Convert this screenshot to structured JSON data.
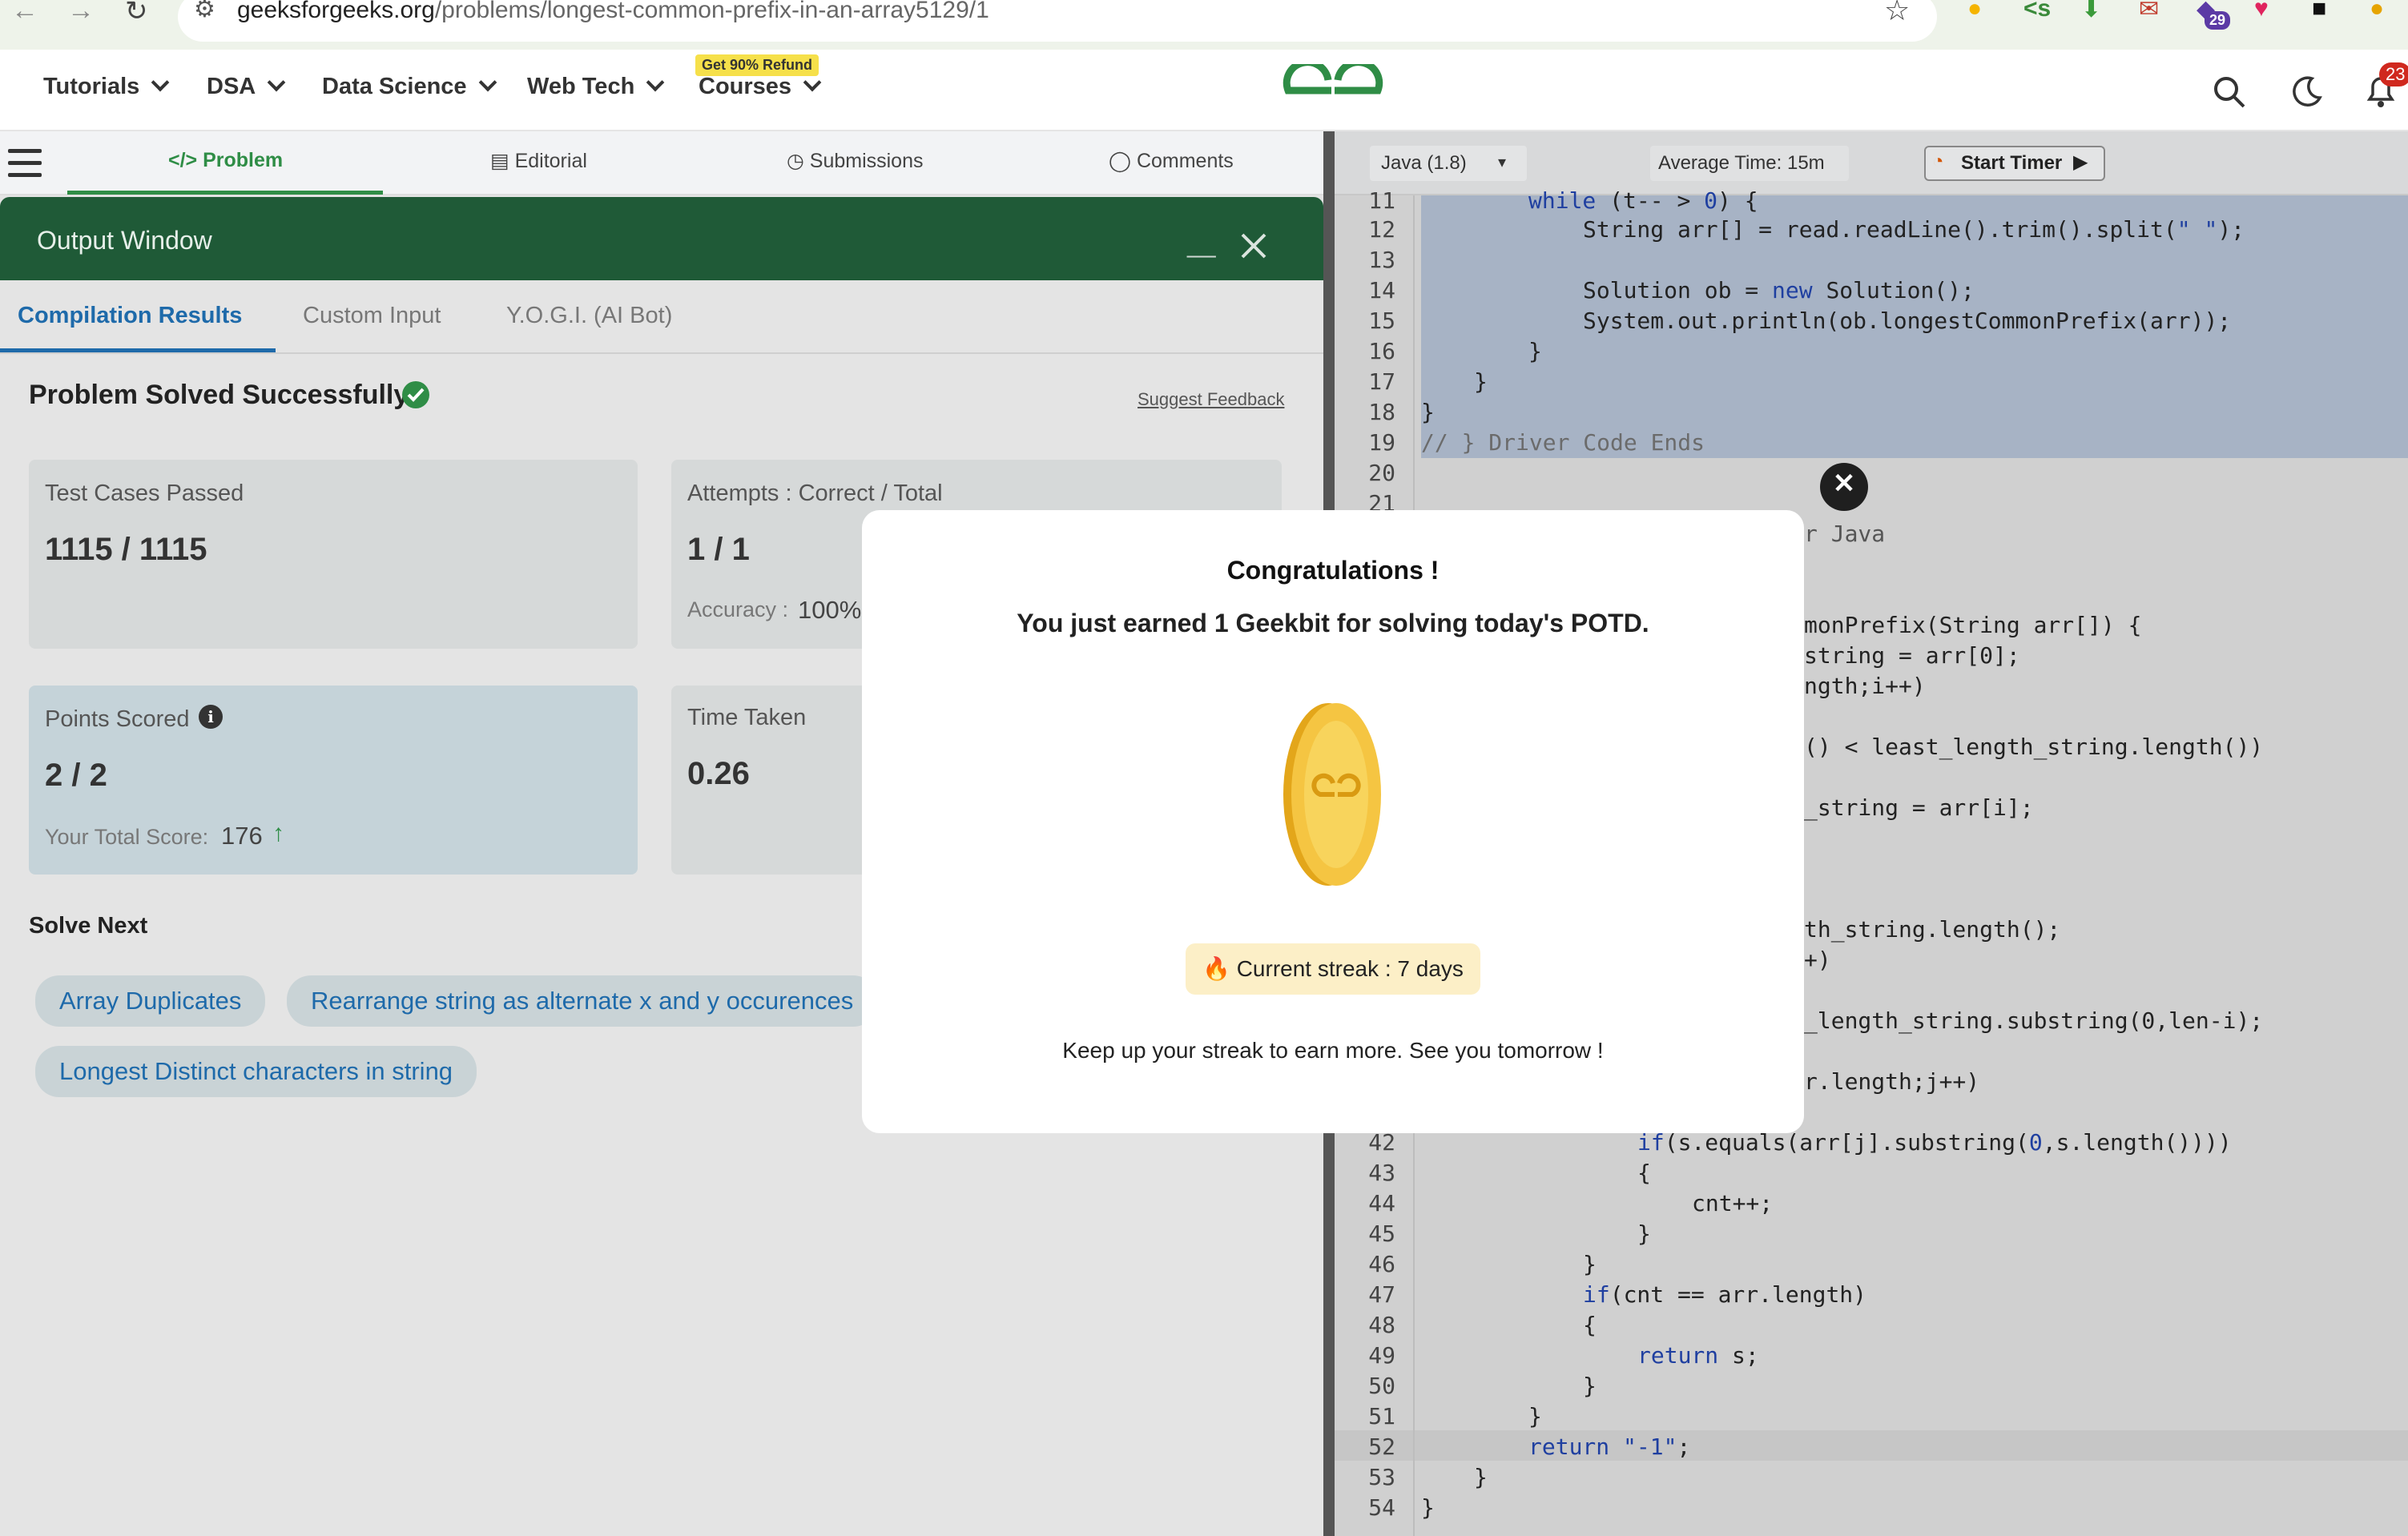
{
  "browser": {
    "url_host": "geeksforgeeks.org",
    "url_path": "/problems/longest-common-prefix-in-an-array5129/1",
    "extension_badge": "29"
  },
  "header": {
    "nav": [
      "Tutorials",
      "DSA",
      "Data Science",
      "Web Tech",
      "Courses"
    ],
    "courses_badge": "Get 90% Refund",
    "notification_count": "23"
  },
  "problem_tabs": [
    "Problem",
    "Editorial",
    "Submissions",
    "Comments"
  ],
  "output_window": {
    "title": "Output Window",
    "minimize": "__",
    "subtabs": [
      "Compilation Results",
      "Custom Input",
      "Y.O.G.I. (AI Bot)"
    ],
    "status": "Problem Solved Successfully",
    "suggest_feedback": "Suggest Feedback",
    "test_cases_label": "Test Cases Passed",
    "test_cases_value": "1115 / 1115",
    "attempts_label": "Attempts : Correct / Total",
    "attempts_value": "1 / 1",
    "accuracy_label": "Accuracy :",
    "accuracy_value": "100%",
    "points_label": "Points Scored",
    "points_value": "2 / 2",
    "total_score_label": "Your Total Score:",
    "total_score_value": "176",
    "time_label": "Time Taken",
    "time_value": "0.26",
    "solve_next_label": "Solve Next",
    "solve_next": [
      "Array Duplicates",
      "Rearrange string as alternate x and y occurences",
      "Longest Distinct characters in string"
    ]
  },
  "editor": {
    "language": "Java (1.8)",
    "avg_time": "Average Time: 15m",
    "start_timer": "Start Timer",
    "line_numbers": [
      "11",
      "12",
      "13",
      "14",
      "15",
      "16",
      "17",
      "18",
      "19",
      "20",
      "21",
      "42",
      "43",
      "44",
      "45",
      "46",
      "47",
      "48",
      "49",
      "50",
      "51",
      "52",
      "53",
      "54"
    ],
    "visible_fragments": [
      "r Java",
      "monPrefix(String arr[]) {",
      "string = arr[0];",
      "ngth;i++)",
      "() < least_length_string.length())",
      "_string = arr[i];",
      "th_string.length();",
      "+)",
      "_length_string.substring(0,len-i);",
      "r.length;j++)"
    ]
  },
  "modal": {
    "title": "Congratulations !",
    "subtitle": "You just earned 1 Geekbit for solving today's POTD.",
    "streak": "🔥 Current streak : 7 days",
    "footer": "Keep up your streak to earn more. See you tomorrow !",
    "close": "✕"
  },
  "colors": {
    "gfg_green": "#2f8d46",
    "output_header": "#1f5a37",
    "link_blue": "#1e6aaa",
    "coin_gold": "#f5c542"
  }
}
